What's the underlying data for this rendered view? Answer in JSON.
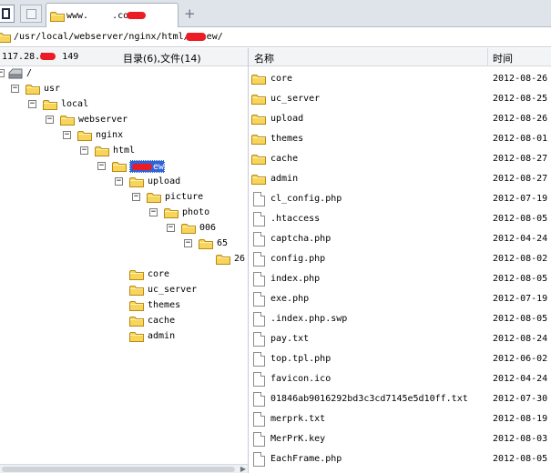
{
  "tabs": {
    "active_label_prefix": "www.",
    "active_label_suffix": ".com",
    "add_glyph": "+"
  },
  "path": {
    "value_prefix": "/usr/local/webserver/nginx/html/",
    "value_suffix": "new/"
  },
  "left_header": {
    "ip_prefix": "117.28.2",
    "ip_suffix": "149",
    "counts": "目录(6),文件(14)"
  },
  "right_header": {
    "name_col": "名称",
    "time_col": "时间"
  },
  "tree": {
    "root": "/",
    "usr": "usr",
    "local": "local",
    "webserver": "webserver",
    "nginx": "nginx",
    "html": "html",
    "selected_suffix": "ew",
    "upload": "upload",
    "picture": "picture",
    "photo": "photo",
    "d006": "006",
    "d65": "65",
    "d26": "26",
    "core": "core",
    "uc_server": "uc_server",
    "themes": "themes",
    "cache": "cache",
    "admin": "admin",
    "expanded_glyph": "−",
    "collapsed_glyph": "+"
  },
  "files": [
    {
      "name": "core",
      "time": "2012-08-26",
      "type": "folder"
    },
    {
      "name": "uc_server",
      "time": "2012-08-25",
      "type": "folder"
    },
    {
      "name": "upload",
      "time": "2012-08-26",
      "type": "folder"
    },
    {
      "name": "themes",
      "time": "2012-08-01",
      "type": "folder"
    },
    {
      "name": "cache",
      "time": "2012-08-27",
      "type": "folder"
    },
    {
      "name": "admin",
      "time": "2012-08-27",
      "type": "folder"
    },
    {
      "name": "cl_config.php",
      "time": "2012-07-19",
      "type": "file"
    },
    {
      "name": ".htaccess",
      "time": "2012-08-05",
      "type": "file"
    },
    {
      "name": "captcha.php",
      "time": "2012-04-24",
      "type": "file"
    },
    {
      "name": "config.php",
      "time": "2012-08-02",
      "type": "file"
    },
    {
      "name": "index.php",
      "time": "2012-08-05",
      "type": "file"
    },
    {
      "name": "exe.php",
      "time": "2012-07-19",
      "type": "file"
    },
    {
      "name": ".index.php.swp",
      "time": "2012-08-05",
      "type": "file"
    },
    {
      "name": "pay.txt",
      "time": "2012-08-24",
      "type": "file"
    },
    {
      "name": "top.tpl.php",
      "time": "2012-06-02",
      "type": "file"
    },
    {
      "name": "favicon.ico",
      "time": "2012-04-24",
      "type": "file"
    },
    {
      "name": "01846ab9016292bd3c3cd7145e5d10ff.txt",
      "time": "2012-07-30",
      "type": "file"
    },
    {
      "name": "merprk.txt",
      "time": "2012-08-19",
      "type": "file"
    },
    {
      "name": "MerPrK.key",
      "time": "2012-08-03",
      "type": "file"
    },
    {
      "name": "EachFrame.php",
      "time": "2012-08-05",
      "type": "file"
    }
  ],
  "colors": {
    "folder_fill": "#f7d45a",
    "folder_stroke": "#b88a12",
    "selection": "#3162d6",
    "redaction": "#ec1c24"
  }
}
